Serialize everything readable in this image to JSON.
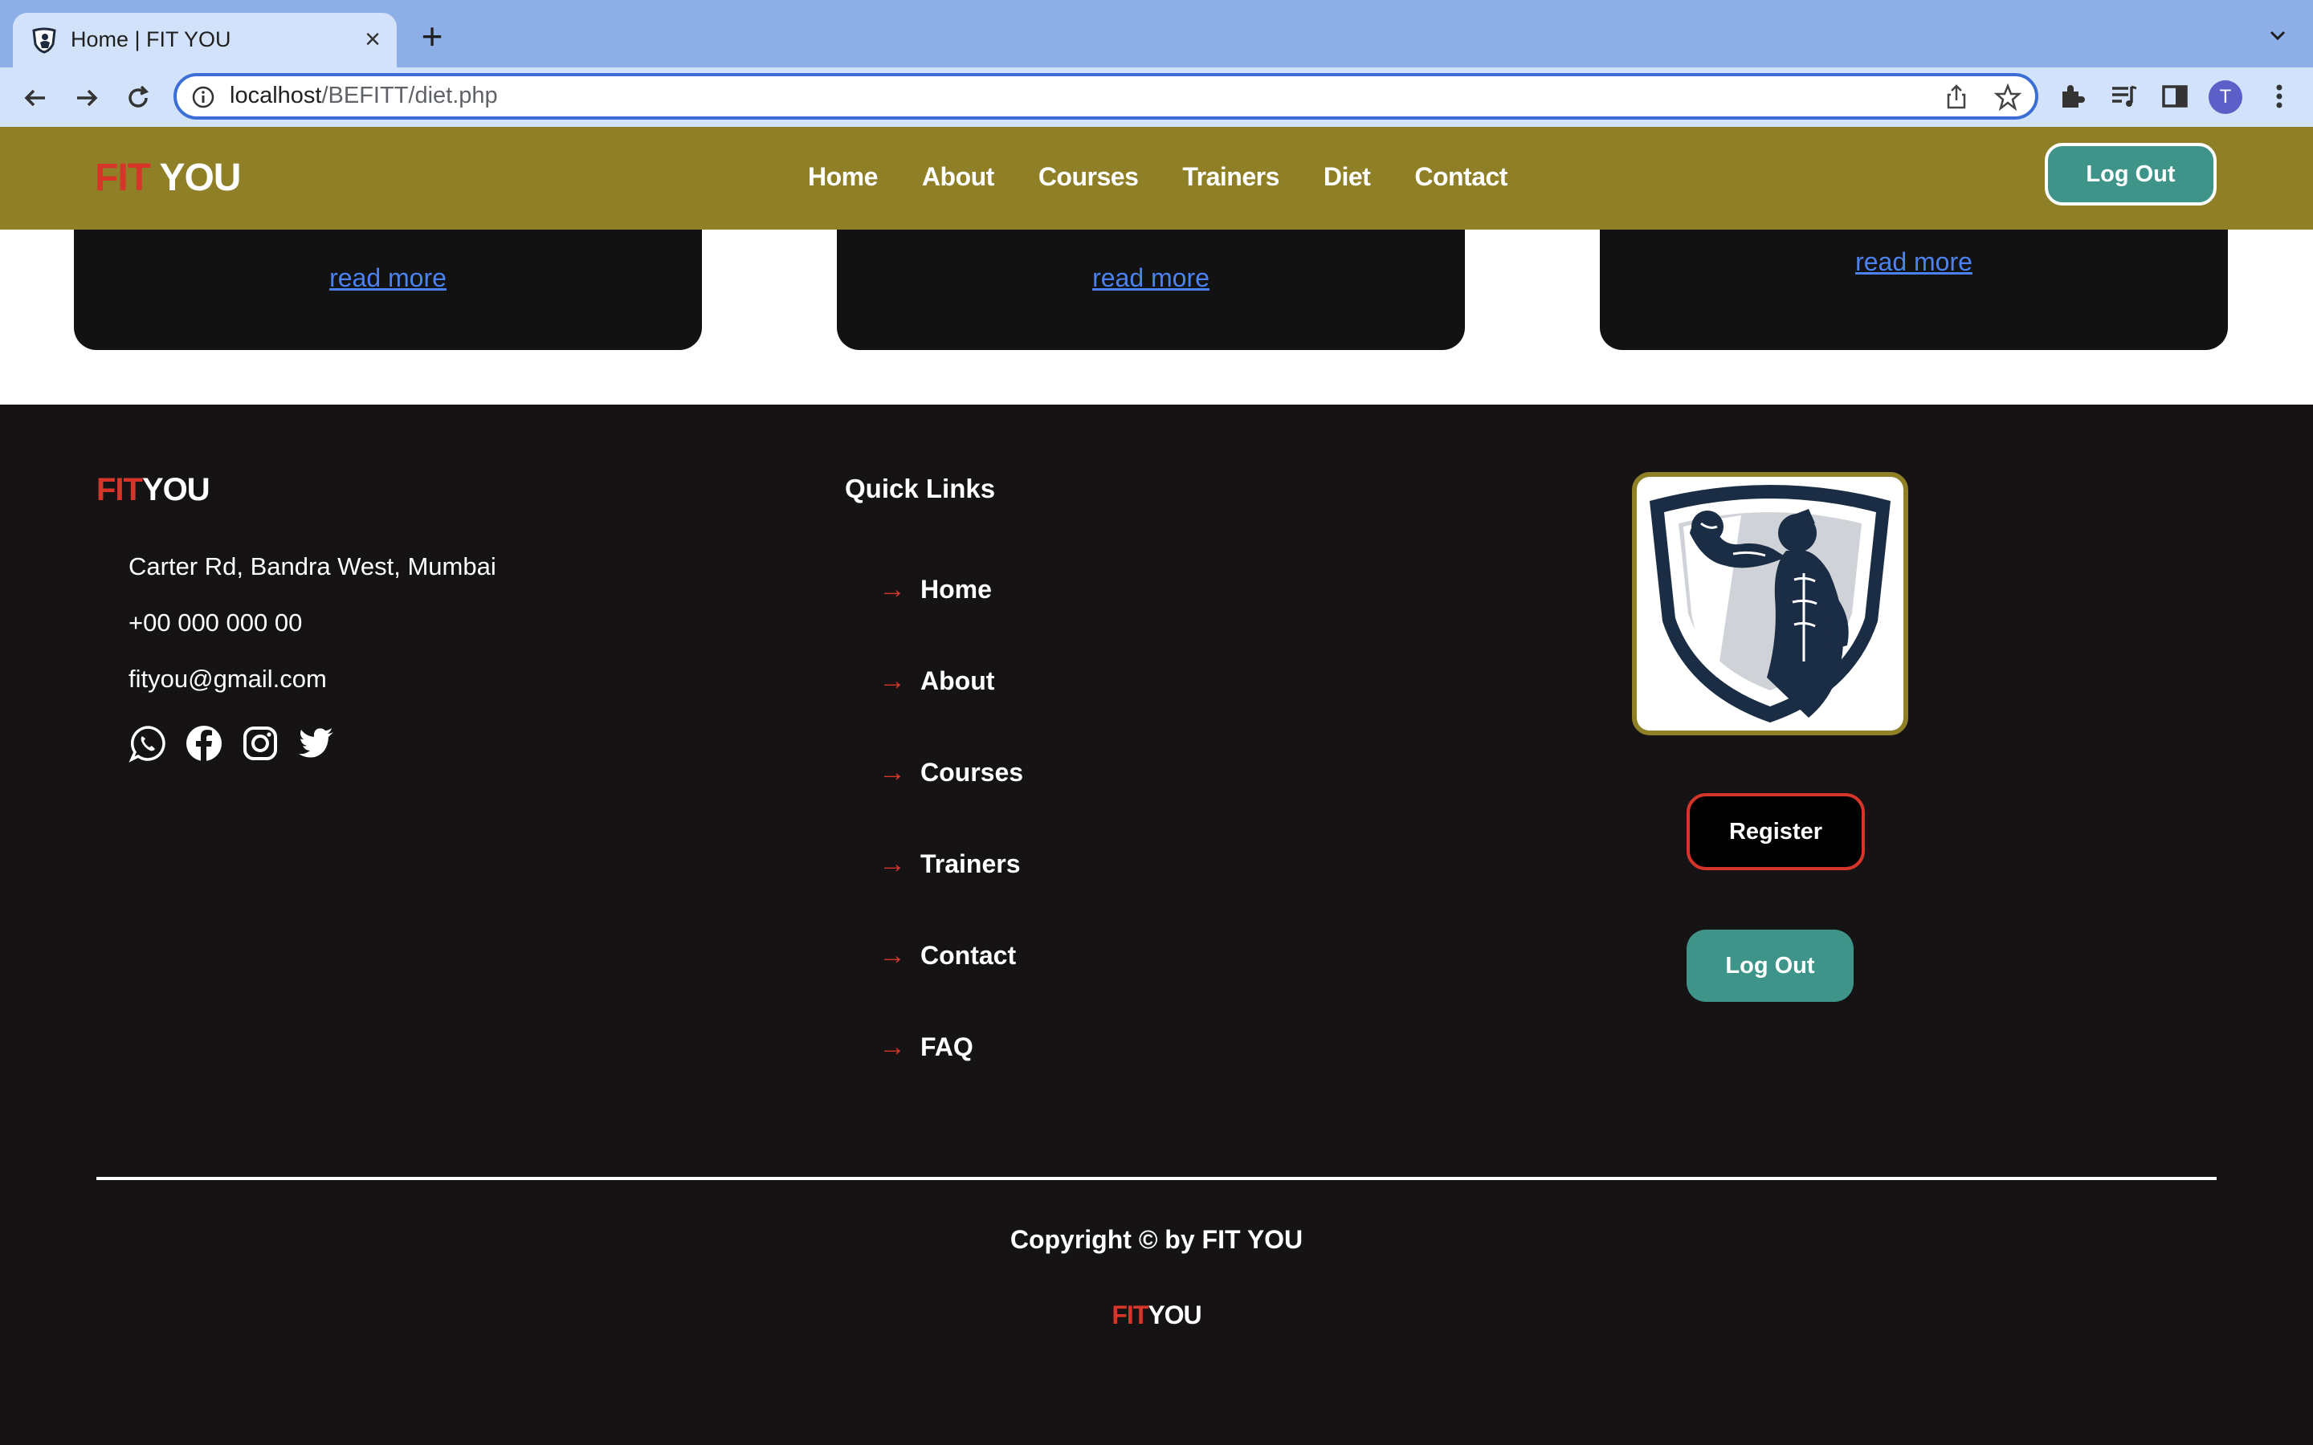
{
  "browser": {
    "tab_title": "Home | FIT YOU",
    "tab_close": "×",
    "new_tab": "+",
    "url_host": "localhost",
    "url_path": "/BEFITT/diet.php",
    "profile_initial": "T"
  },
  "header": {
    "brand_fit": "FIT",
    "brand_you": " YOU",
    "nav": [
      "Home",
      "About",
      "Courses",
      "Trainers",
      "Diet",
      "Contact"
    ],
    "logout_label": "Log Out",
    "background_color": "#8f7f27"
  },
  "cards": [
    {
      "link": "read more"
    },
    {
      "link": "read more"
    },
    {
      "link": "read more"
    }
  ],
  "footer": {
    "brand_fit": "FIT",
    "brand_you": "YOU",
    "address": "Carter Rd, Bandra West, Mumbai",
    "phone": "+00 000 000 00",
    "email": "fityou@gmail.com",
    "social_icons": [
      "whatsapp-icon",
      "facebook-icon",
      "instagram-icon",
      "twitter-icon"
    ],
    "quick_links_title": "Quick Links",
    "quick_links": [
      "Home",
      "About",
      "Courses",
      "Trainers",
      "Contact",
      "FAQ"
    ],
    "arrow": "→",
    "register_label": "Register",
    "logout_label": "Log Out",
    "copyright": "Copyright © by FIT YOU",
    "bottom_brand_fit": "FIT",
    "bottom_brand_you": "YOU"
  },
  "colors": {
    "accent_red": "#d8352a",
    "teal_button": "#3f9489",
    "link_blue": "#4c82f0",
    "footer_bg": "#151314"
  }
}
